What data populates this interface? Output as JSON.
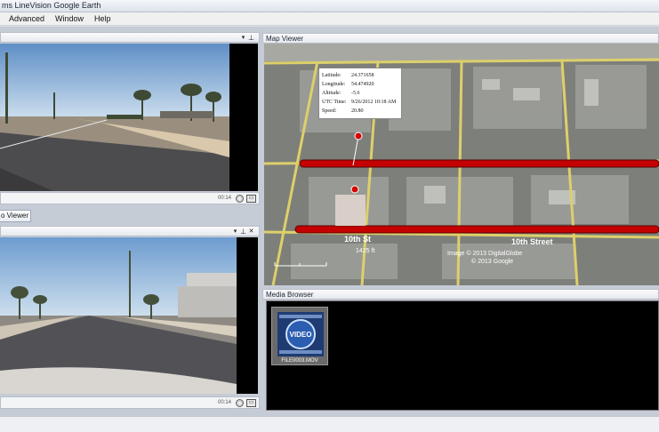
{
  "window": {
    "title": "ms LineVision Google Earth"
  },
  "menu": {
    "items": [
      "Advanced",
      "Window",
      "Help"
    ]
  },
  "video1": {
    "time": "00:14"
  },
  "video2": {
    "time": "00:14",
    "tab_label": "o Viewer"
  },
  "map_viewer": {
    "title": "Map Viewer",
    "popup": {
      "rows": [
        {
          "label": "Latitude:",
          "value": "24.371658"
        },
        {
          "label": "Longitude:",
          "value": "54.474920"
        },
        {
          "label": "Altitude:",
          "value": "-5.6"
        },
        {
          "label": "UTC Time:",
          "value": "9/26/2012 10:18 AM"
        },
        {
          "label": "Speed:",
          "value": "20.80"
        }
      ]
    },
    "street_labels": [
      "10th St",
      "10th Street"
    ],
    "scale": "1425 ft",
    "attribution": [
      "Image © 2013 DigitalGlobe",
      "© 2013 Google"
    ]
  },
  "media_browser": {
    "title": "Media Browser",
    "thumbnail": {
      "badge": "VIDEO",
      "filename": "FILE0003.MOV"
    }
  },
  "colors": {
    "track": "#c40000",
    "road": "#e2d36a",
    "sky": "#8fb7dd"
  }
}
